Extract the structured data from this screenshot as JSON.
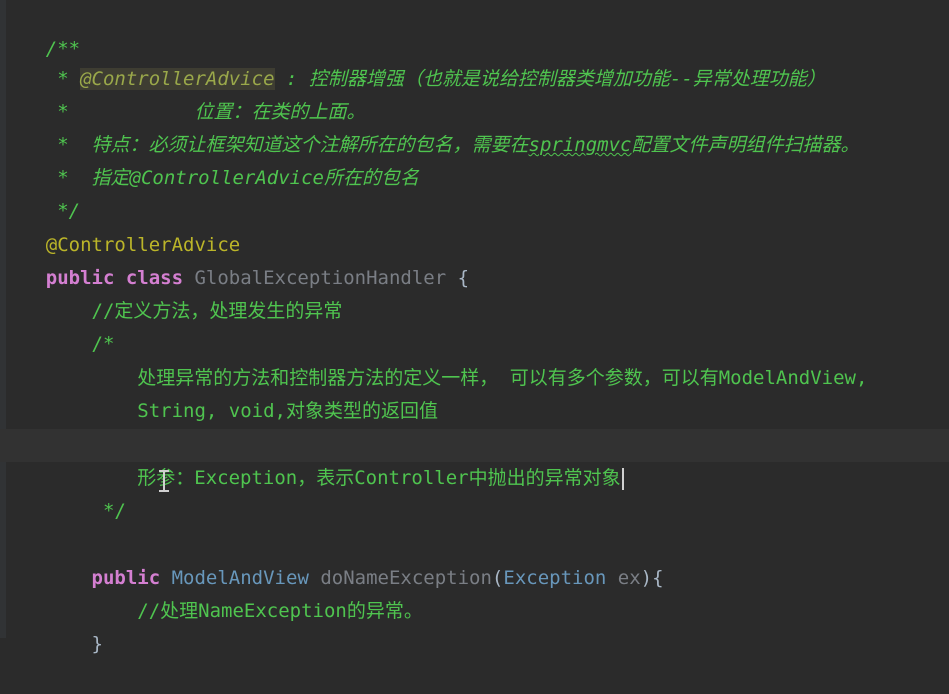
{
  "editor": {
    "lines": [
      {
        "id": "l1",
        "text": "/**"
      },
      {
        "id": "l2a",
        "text": " * "
      },
      {
        "id": "l2b",
        "text": "@ControllerAdvice"
      },
      {
        "id": "l2c",
        "text": " : 控制器增强（也就是说给控制器类增加功能--异常处理功能）"
      },
      {
        "id": "l3",
        "text": " *           位置：在类的上面。"
      },
      {
        "id": "l4a",
        "text": " *  特点：必须让框架知道这个注解所在的包名，需要在"
      },
      {
        "id": "l4b",
        "text": "springmvc"
      },
      {
        "id": "l4c",
        "text": "配置文件声明组件扫描器。"
      },
      {
        "id": "l5",
        "text": " *  指定@ControllerAdvice所在的包名"
      },
      {
        "id": "l6",
        "text": " */"
      },
      {
        "id": "l7",
        "text": "@ControllerAdvice"
      },
      {
        "id": "l8a",
        "text": "public class "
      },
      {
        "id": "l8b",
        "text": "GlobalExceptionHandler"
      },
      {
        "id": "l8c",
        "text": " {"
      },
      {
        "id": "l9",
        "text": "    //定义方法，处理发生的异常"
      },
      {
        "id": "l10",
        "text": "    /*"
      },
      {
        "id": "l11",
        "text": "        处理异常的方法和控制器方法的定义一样， 可以有多个参数，可以有ModelAndView,"
      },
      {
        "id": "l12",
        "text": "        String, void,对象类型的返回值"
      },
      {
        "id": "l13",
        "text": "        形参：Exception，表示Controller中抛出的异常对象"
      },
      {
        "id": "l14",
        "text": "     */"
      },
      {
        "id": "l15a",
        "text": "    public "
      },
      {
        "id": "l15b",
        "text": "ModelAndView"
      },
      {
        "id": "l15c",
        "text": " doNameException"
      },
      {
        "id": "l15d",
        "text": "("
      },
      {
        "id": "l15e",
        "text": "Exception"
      },
      {
        "id": "l15f",
        "text": " ex"
      },
      {
        "id": "l15g",
        "text": "){"
      },
      {
        "id": "l16",
        "text": "        //处理NameException的异常。"
      },
      {
        "id": "l17",
        "text": "    }"
      }
    ]
  },
  "colors": {
    "background": "#2b2b2b",
    "comment": "#4fc44f",
    "keyword": "#cc7832",
    "annotation": "#bbb529",
    "type": "#6897bb",
    "text": "#a9b7c6"
  }
}
